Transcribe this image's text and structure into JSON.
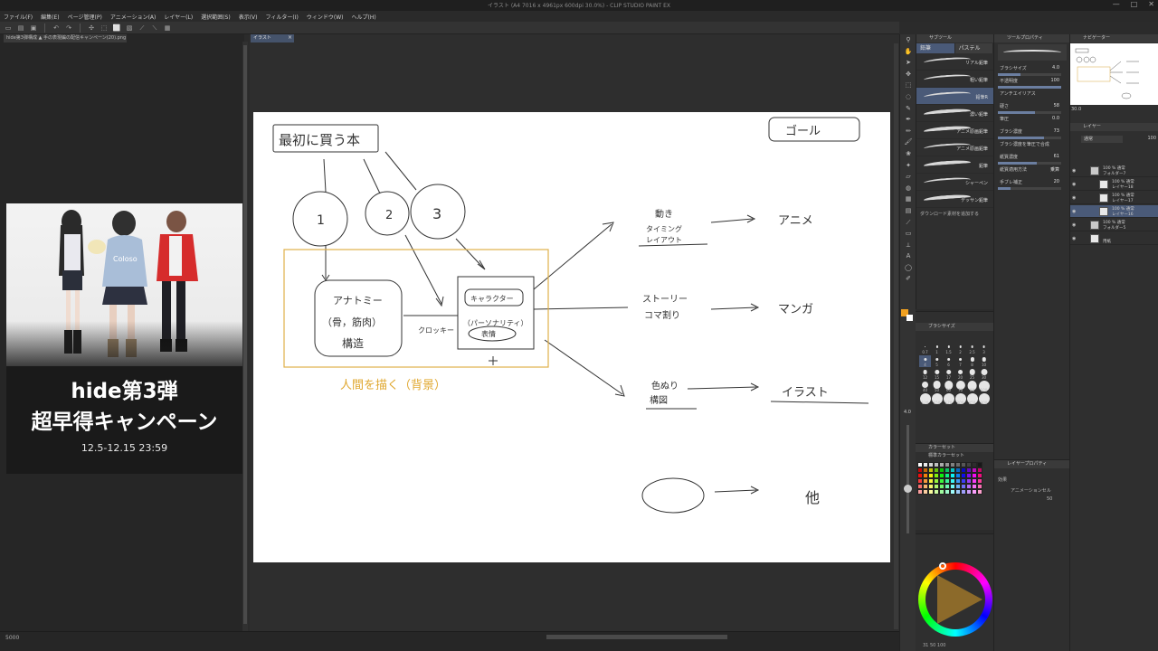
{
  "window": {
    "title": "イラスト (A4 7016 x 4961px 600dpi 30.0%) - CLIP STUDIO PAINT EX"
  },
  "menu": [
    "ファイル(F)",
    "編集(E)",
    "ページ管理(P)",
    "アニメーション(A)",
    "レイヤー(L)",
    "選択範囲(S)",
    "表示(V)",
    "フィルター(I)",
    "ウィンドウ(W)",
    "ヘルプ(H)"
  ],
  "left_panel": {
    "tab": "hide第3弾構成 ▲ 手の表現編の配信キャンペーン(20).png",
    "zoom": "5000"
  },
  "ad": {
    "line1": "hide第3弾",
    "line2": "超早得キャンペーン",
    "date": "12.5-12.15 23:59"
  },
  "canvas": {
    "tab": "イラスト"
  },
  "drawing": {
    "top_box": "最初に買う本",
    "goal": "ゴール",
    "circles": [
      "1",
      "2",
      "3"
    ],
    "anatomy": [
      "アナトミー",
      "（骨，筋肉）",
      "構造"
    ],
    "croquis": "クロッキー",
    "character": [
      "キャラクター",
      "（パーソナリティ）",
      "表情"
    ],
    "human": "人間を描く（背景）",
    "rows": [
      {
        "left": [
          "動き",
          "タイミング",
          "レイアウト"
        ],
        "right": "アニメ"
      },
      {
        "left": [
          "ストーリー",
          "コマ割り"
        ],
        "right": "マンガ"
      },
      {
        "left": [
          "色ぬり",
          "構図"
        ],
        "right": "イラスト"
      },
      {
        "left": [],
        "right": "他"
      }
    ]
  },
  "sub_tool": {
    "title": "サブツール",
    "tabs": [
      "鉛筆",
      "パステル"
    ],
    "brushes": [
      "リアル鉛筆",
      "粗い鉛筆",
      "鉛筆R",
      "濃い鉛筆",
      "アニメ原画鉛筆",
      "アニメ原画鉛筆",
      "鉛筆",
      "シャーペン",
      "デッサン鉛筆"
    ],
    "download": "ダウンロード素材を追加する"
  },
  "brush_size": {
    "title": "ブラシサイズ",
    "sizes": [
      "0.7",
      "1",
      "1.5",
      "2",
      "2.5",
      "3",
      "4",
      "5",
      "6",
      "7",
      "8",
      "10",
      "12",
      "15",
      "17",
      "20",
      "25",
      "30",
      "40",
      "50",
      "60",
      "70",
      "80",
      "100",
      "120",
      "150",
      "170",
      "200",
      "250",
      "300"
    ],
    "selected": "4"
  },
  "color_set": {
    "title": "カラーセット",
    "name": "標準カラーセット"
  },
  "color_wheel": {
    "readout": "31 50 100"
  },
  "tool_property": {
    "title": "ツールプロパティ",
    "rows": [
      {
        "label": "ブラシサイズ",
        "value": "4.0",
        "fill": 0.35
      },
      {
        "label": "不透明度",
        "value": "100",
        "fill": 1.0
      },
      {
        "label": "アンチエイリアス",
        "value": "",
        "fill": 0
      },
      {
        "label": "硬さ",
        "value": "58",
        "fill": 0.58
      },
      {
        "label": "筆圧",
        "value": "0.0",
        "fill": 0
      },
      {
        "label": "ブラシ濃度",
        "value": "73",
        "fill": 0.73
      },
      {
        "label": "ブラシ濃度を筆圧で合成",
        "value": "",
        "fill": 0
      },
      {
        "label": "紙質濃度",
        "value": "61",
        "fill": 0.61
      },
      {
        "label": "紙質適用方法",
        "value": "乗算",
        "fill": 0
      },
      {
        "label": "手ブレ補正",
        "value": "20",
        "fill": 0.2
      }
    ]
  },
  "layer_property": {
    "title": "レイヤープロパティ",
    "effect": "効果",
    "animation": "アニメーションセル",
    "value": "50"
  },
  "navigator": {
    "title": "ナビゲーター",
    "zoom": "30.0"
  },
  "layers": {
    "title": "レイヤー",
    "blend": "通常",
    "opacity": "100",
    "items": [
      {
        "line1": "100 % 通常",
        "line2": "フォルダー7",
        "type": "folder",
        "indent": 1,
        "selected": false
      },
      {
        "line1": "100 % 通常",
        "line2": "レイヤー18",
        "type": "layer",
        "indent": 2,
        "selected": false
      },
      {
        "line1": "100 % 通常",
        "line2": "レイヤー17",
        "type": "layer",
        "indent": 2,
        "selected": false
      },
      {
        "line1": "100 % 通常",
        "line2": "レイヤー16",
        "type": "layer",
        "indent": 2,
        "selected": true
      },
      {
        "line1": "100 % 通常",
        "line2": "フォルダー5",
        "type": "folder",
        "indent": 1,
        "selected": false
      },
      {
        "line1": "",
        "line2": "用紙",
        "type": "paper",
        "indent": 1,
        "selected": false
      }
    ]
  }
}
